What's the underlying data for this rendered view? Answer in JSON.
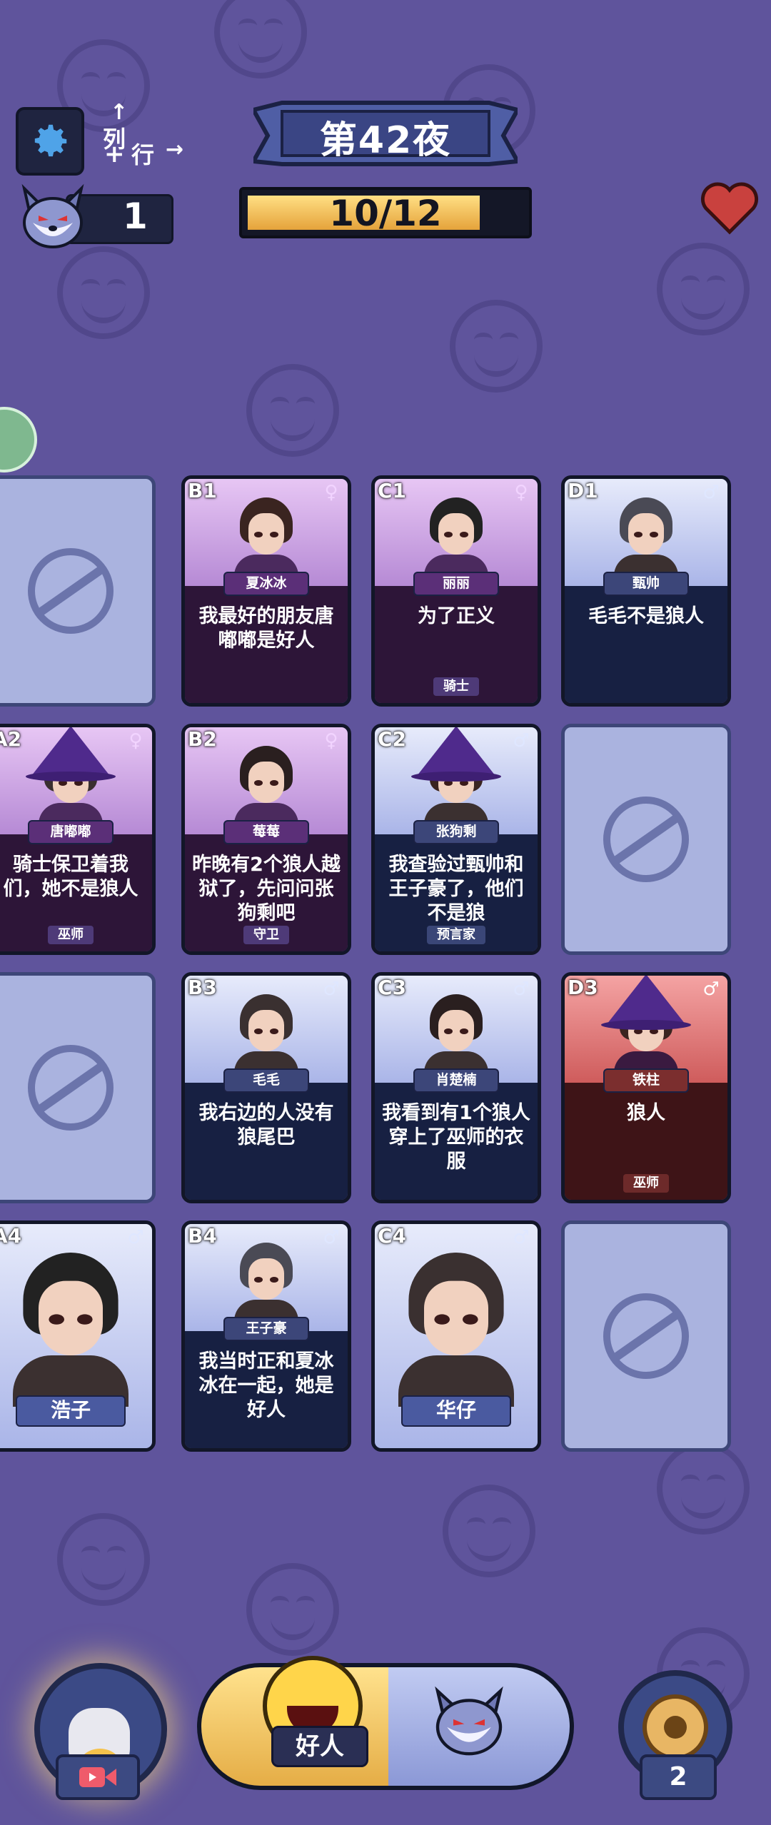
{
  "header": {
    "night_title": "第42夜",
    "progress_text": "10/12",
    "progress_fraction": 0.8333,
    "wolf_count": "1",
    "orientation": {
      "col": "列",
      "row": "行"
    }
  },
  "cards": [
    {
      "id": "A1",
      "empty": true
    },
    {
      "id": "B1",
      "coord": "B1",
      "gender": "female",
      "name": "夏冰冰",
      "statement": "我最好的朋友唐嘟嘟是好人",
      "role": ""
    },
    {
      "id": "C1",
      "coord": "C1",
      "gender": "female",
      "name": "丽丽",
      "statement": "为了正义",
      "role": "骑士"
    },
    {
      "id": "D1",
      "coord": "D1",
      "gender": "male",
      "name": "甄帅",
      "statement": "毛毛不是狼人",
      "role": ""
    },
    {
      "id": "A2",
      "coord": "A2",
      "gender": "female",
      "name": "唐嘟嘟",
      "statement": "骑士保卫着我们，她不是狼人",
      "role": "巫师"
    },
    {
      "id": "B2",
      "coord": "B2",
      "gender": "female",
      "name": "莓莓",
      "statement": "昨晚有2个狼人越狱了，先问问张狗剩吧",
      "role": "守卫"
    },
    {
      "id": "C2",
      "coord": "C2",
      "gender": "male",
      "name": "张狗剩",
      "statement": "我查验过甄帅和王子豪了，他们不是狼",
      "role": "预言家"
    },
    {
      "id": "D2",
      "empty": true
    },
    {
      "id": "A3",
      "empty": true
    },
    {
      "id": "B3",
      "coord": "B3",
      "gender": "male",
      "name": "毛毛",
      "statement": "我右边的人没有狼尾巴",
      "role": ""
    },
    {
      "id": "C3",
      "coord": "C3",
      "gender": "male",
      "name": "肖楚楠",
      "statement": "我看到有1个狼人穿上了巫师的衣服",
      "role": ""
    },
    {
      "id": "D3",
      "coord": "D3",
      "gender": "male",
      "name": "铁柱",
      "statement": "狼人",
      "role": "巫师",
      "wolf": true
    },
    {
      "id": "A4",
      "coord": "A4",
      "gender": "male",
      "name": "浩子",
      "big": true
    },
    {
      "id": "B4",
      "coord": "B4",
      "gender": "male",
      "name": "王子豪",
      "statement": "我当时正和夏冰冰在一起，她是好人",
      "role": ""
    },
    {
      "id": "C4",
      "coord": "C4",
      "gender": "male",
      "name": "华仔",
      "big": true
    },
    {
      "id": "D4",
      "empty": true
    }
  ],
  "bottom": {
    "toggle_label": "好人",
    "eye_count": "2"
  },
  "colors": {
    "background": "#5f549c",
    "female_card": "#b68ad5",
    "male_card": "#aab5e8",
    "wolf_card": "#cf5c5c",
    "accent_gold": "#e5ad46"
  },
  "icons": [
    "gear-icon",
    "wolf-icon",
    "heart-icon",
    "ban-icon",
    "video-icon",
    "eye-icon",
    "female-icon",
    "male-icon"
  ]
}
